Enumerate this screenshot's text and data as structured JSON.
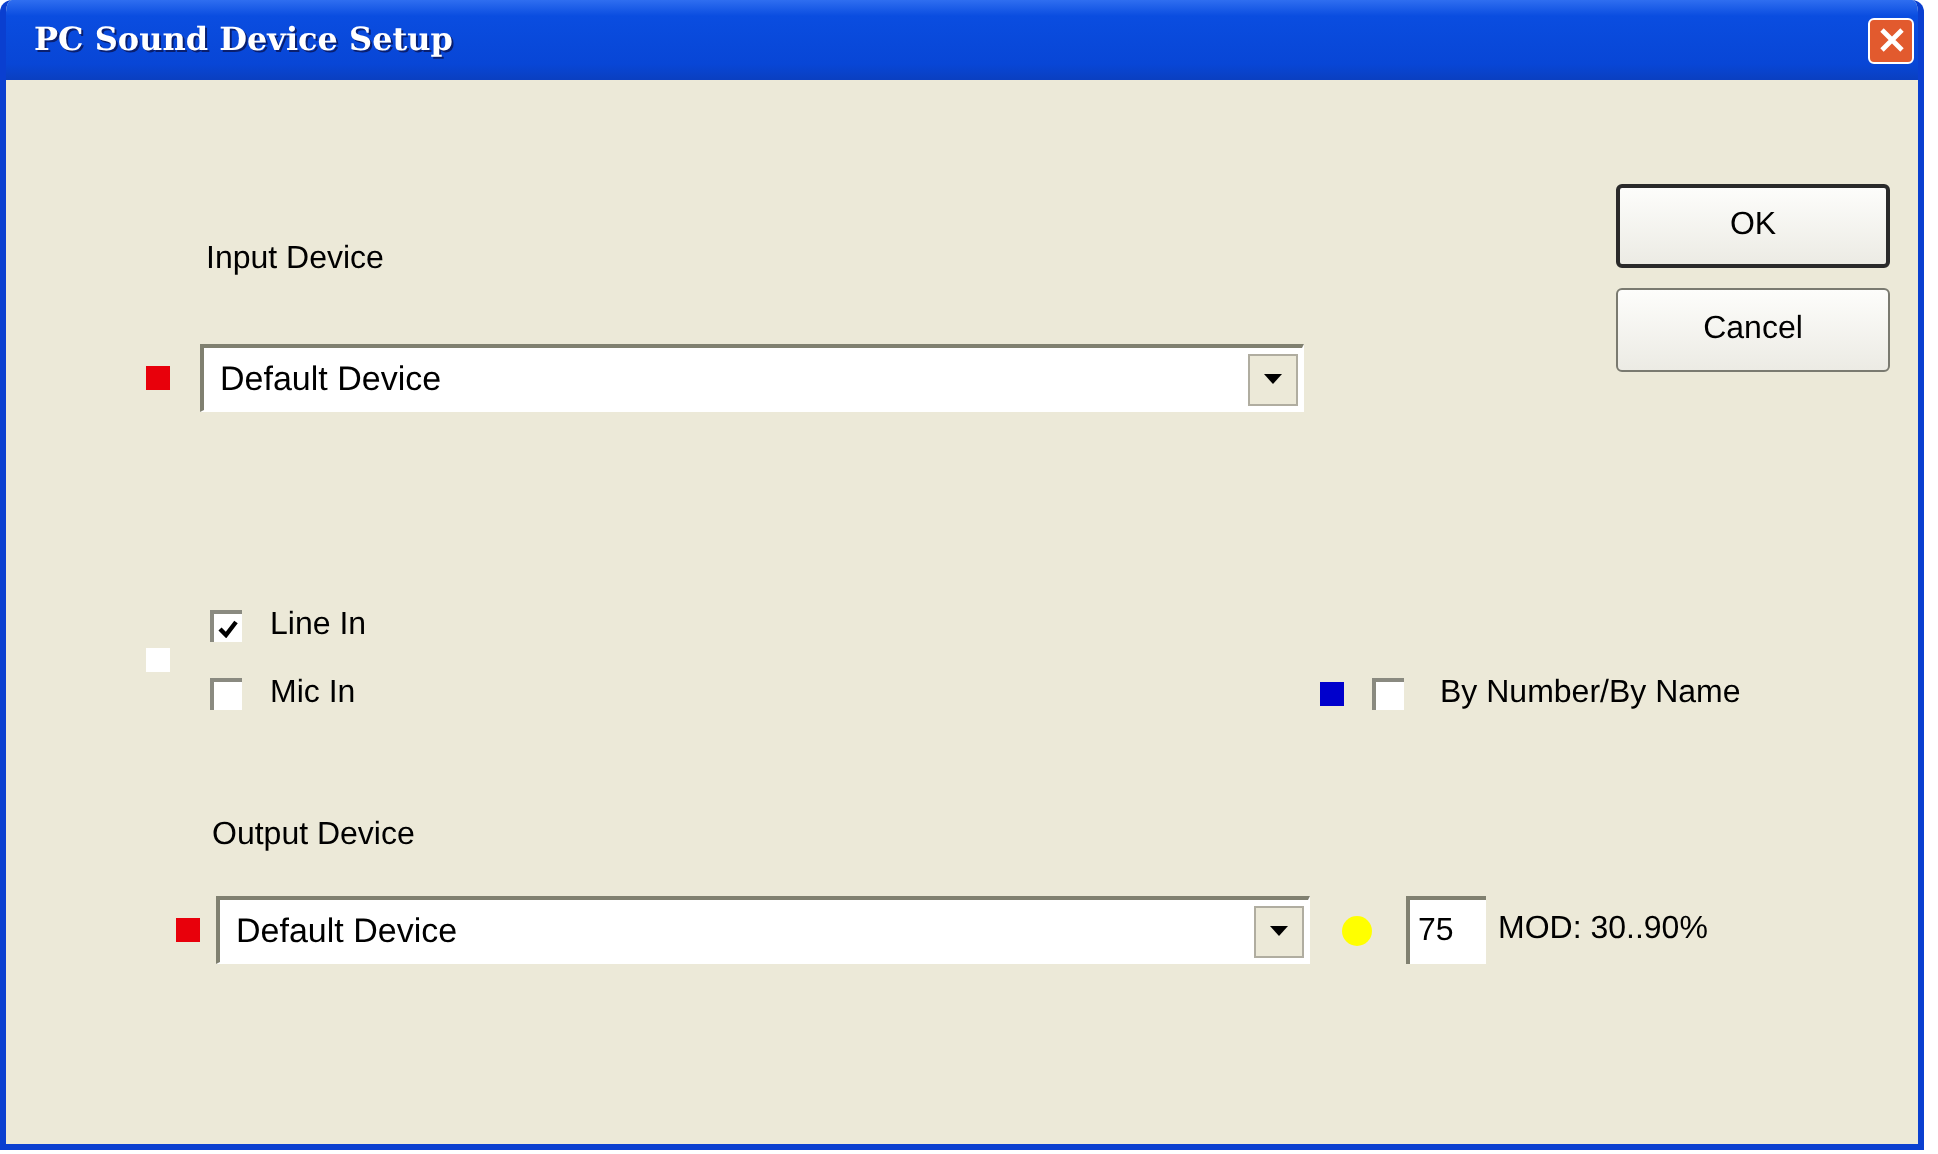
{
  "window": {
    "title": "PC Sound Device Setup"
  },
  "input_device": {
    "label": "Input Device",
    "indicator": {
      "color": "#e8000b"
    },
    "value": "Default Device"
  },
  "buttons": [
    {
      "label": "OK",
      "default": true
    },
    {
      "label": "Cancel",
      "default": false
    }
  ],
  "sources": {
    "indicator": {
      "color": "#ffffff"
    },
    "options": [
      {
        "label": "Line In",
        "checked": true
      },
      {
        "label": "Mic In",
        "checked": false
      }
    ]
  },
  "by_number": {
    "indicator": {
      "color": "#0000cc"
    },
    "label": "By Number/By Name",
    "checked": false
  },
  "output_device": {
    "label": "Output Device",
    "indicator": {
      "color": "#e8000b"
    },
    "value": "Default Device"
  },
  "mod": {
    "indicator": {
      "color": "#ffff00"
    },
    "value": "75",
    "label": "MOD: 30..90%"
  }
}
